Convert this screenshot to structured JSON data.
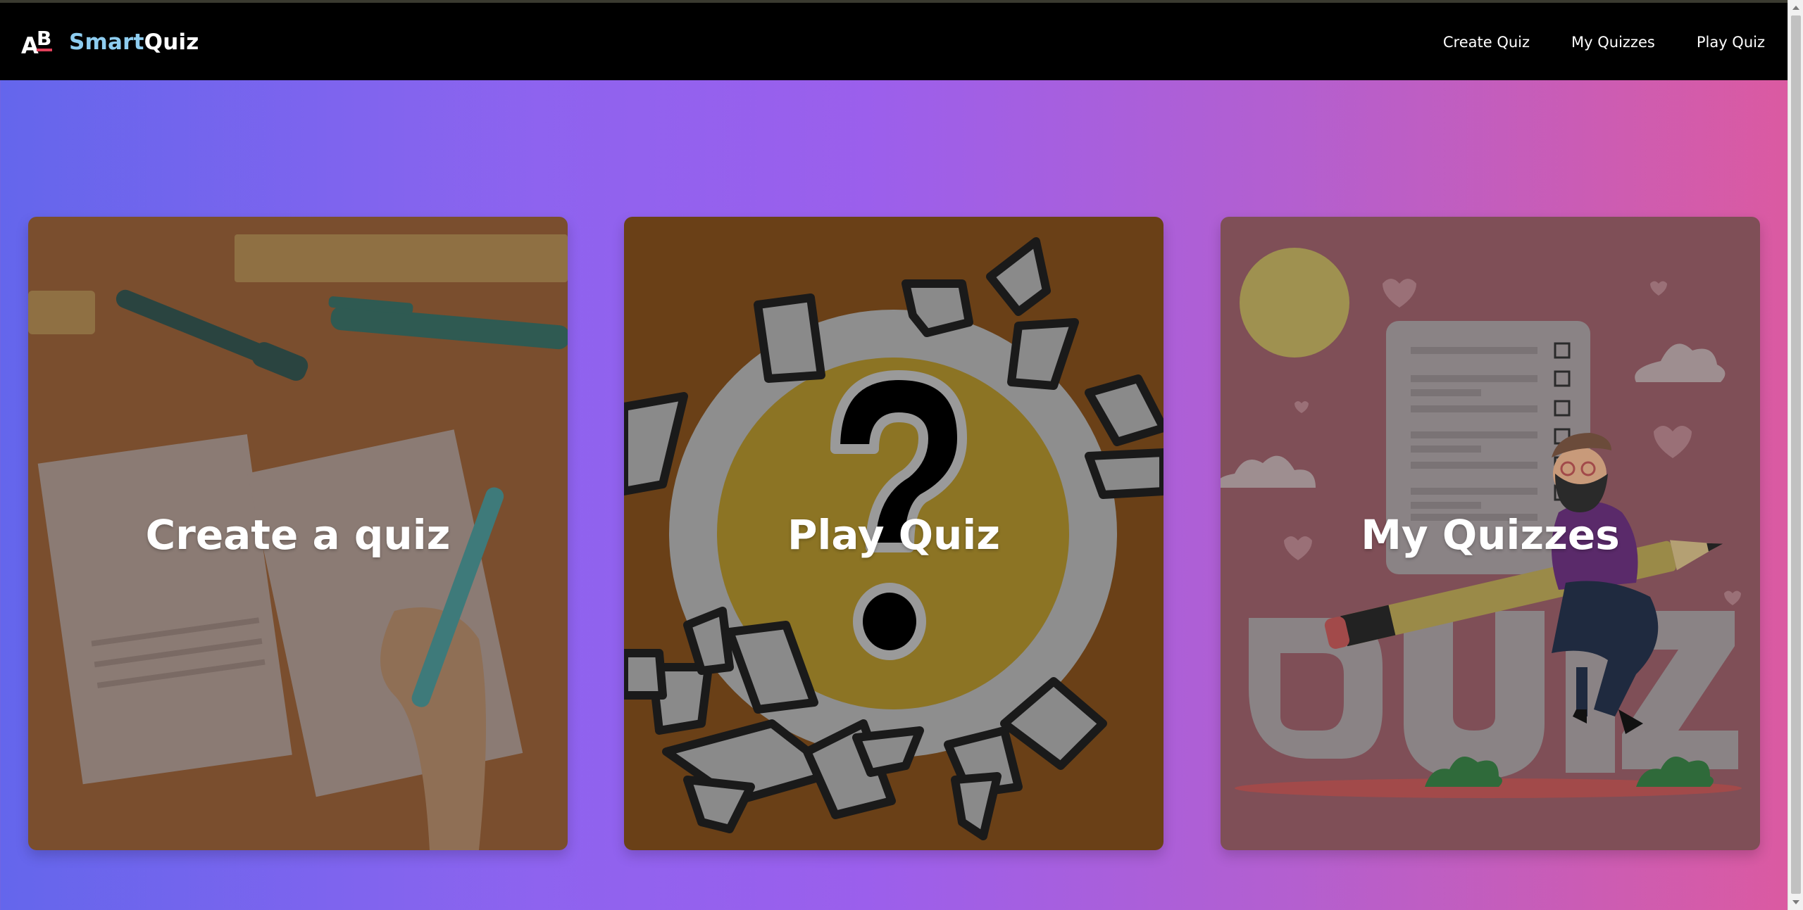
{
  "navbar": {
    "brand": {
      "part1": "Smart",
      "part2": "Quiz",
      "logo_icon": "ab-logo-icon"
    },
    "links": [
      {
        "label": "Create Quiz"
      },
      {
        "label": "My Quizzes"
      },
      {
        "label": "Play Quiz"
      }
    ]
  },
  "cards": [
    {
      "title": "Create a quiz",
      "image": "desk-notes-pens-illustration"
    },
    {
      "title": "Play Quiz",
      "image": "question-mark-burst-illustration"
    },
    {
      "title": "My Quizzes",
      "image": "quiz-checklist-character-illustration",
      "art_text": "QUIZ"
    }
  ],
  "colors": {
    "navbar_bg": "#000000",
    "brand_accent": "#8ecdf0",
    "gradient_start": "#6466ec",
    "gradient_end": "#dc5aa0"
  }
}
